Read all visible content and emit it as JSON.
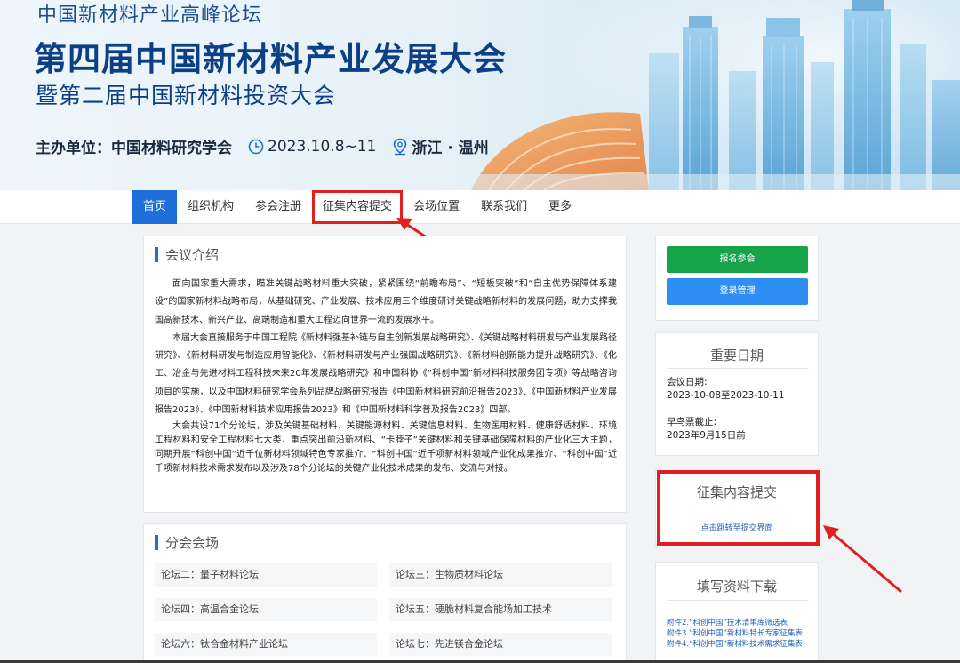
{
  "banner": {
    "subtitle": "中国新材料产业高峰论坛",
    "title": "第四届中国新材料产业发展大会",
    "second_title": "暨第二届中国新材料投资大会",
    "organizer": "主办单位：中国材料研究学会",
    "date": "2023.10.8~11",
    "location": "浙江 · 温州"
  },
  "nav": {
    "items": [
      "首页",
      "组织机构",
      "参会注册",
      "征集内容提交",
      "会场位置",
      "联系我们",
      "更多"
    ],
    "active_index": 0,
    "highlight_index": 3
  },
  "intro": {
    "title": "会议介绍",
    "paragraphs": [
      "面向国家重大需求，瞄准关键战略材料重大突破，紧紧围绕“前瞻布局”、“短板突破”和“自主优势保障体系建设”的国家新材料战略布局，从基础研究、产业发展、技术应用三个维度研讨关键战略新材料的发展问题，助力支撑我国高新技术、新兴产业、高端制造和重大工程迈向世界一流的发展水平。",
      "本届大会直接服务于中国工程院《新材料强基补链与自主创新发展战略研究》、《关键战略材料研发与产业发展路径研究》、《新材料研发与制造应用智能化》、《新材料研发与产业强国战略研究》、《新材料创新能力提升战略研究》、《化工、冶金与先进材料工程科技未来20年发展战略研究》和中国科协《“科创中国”新材料科技服务团专项》等战略咨询项目的实施，以及中国材料研究学会系列品牌战略研究报告《中国新材料研究前沿报告2023》、《中国新材料产业发展报告2023》、《中国新材料技术应用报告2023》和《中国新材料科学普及报告2023》四部。",
      "大会共设71个分论坛，涉及关键基础材料、关键能源材料、关键信息材料、生物医用材料、健康舒适材料、环境工程材料和安全工程材料七大类，重点突出前沿新材料、“卡脖子”关键材料和关键基础保障材料的产业化三大主题，同期开展“科创中国”近千位新材料领域特色专家推介、“科创中国”近千项新材料领域产业化成果推介、“科创中国”近千项新材料技术需求发布以及涉及78个分论坛的关键产业化技术成果的发布、交流与对接。"
    ]
  },
  "forums": {
    "title": "分会会场",
    "items": [
      "论坛二：量子材料论坛",
      "论坛三：生物质材料论坛",
      "论坛四：高温合金论坛",
      "论坛五：硬脆材料复合能场加工技术",
      "论坛六：钛合金材料产业论坛",
      "论坛七：先进镁合金论坛"
    ]
  },
  "sidebar": {
    "register_button": "报名参会",
    "login_button": "登录管理",
    "dates_title": "重要日期",
    "meeting_date_label": "会议日期:",
    "meeting_date_value": "2023-10-08至2023-10-11",
    "early_bird_label": "早鸟票截止:",
    "early_bird_value": "2023年9月15日前",
    "submit_title": "征集内容提交",
    "submit_link": "点击跳转至提交界面",
    "download_title": "填写资料下载",
    "downloads": [
      "附件2.“科创中国”技术清单库筛选表",
      "附件3.“科创中国”新材料特长专家征集表",
      "附件4.“科创中国”新材料技术需求征集表"
    ]
  },
  "colors": {
    "primary": "#1e6fd9",
    "green": "#16a34a",
    "blue_button": "#2f8ef4",
    "highlight_red": "#e02020",
    "banner_title": "#0d3f86"
  }
}
